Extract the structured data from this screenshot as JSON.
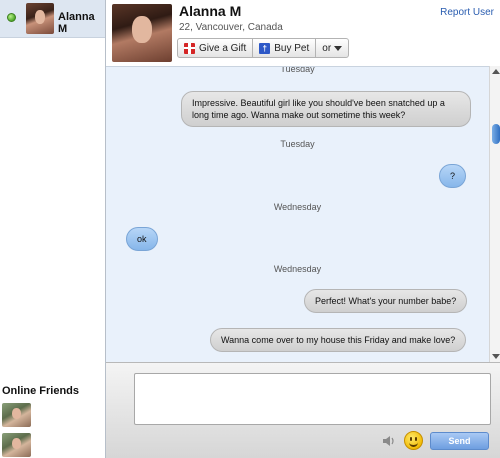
{
  "sidebar": {
    "active_chat": {
      "name": "Alanna M",
      "status": "online"
    },
    "online_friends_title": "Online Friends"
  },
  "profile": {
    "name": "Alanna M",
    "details": "22, Vancouver, Canada",
    "report_label": "Report User"
  },
  "actions": {
    "gift_label": "Give a Gift",
    "pet_label": "Buy Pet",
    "more_label": "or"
  },
  "conversation": {
    "day_top": "Tuesday",
    "msg1": "Impressive. Beautiful girl like you should've been snatched up a long time ago. Wanna make out sometime this week?",
    "day2": "Tuesday",
    "msg2": "?",
    "day3": "Wednesday",
    "msg3": "ok",
    "day4": "Wednesday",
    "msg4": "Perfect! What's your number babe?",
    "msg5": "Wanna come over to my house this Friday and make love?"
  },
  "composer": {
    "input_value": "",
    "send_label": "Send"
  },
  "colors": {
    "accent": "#2a5db0",
    "status_online": "#4fa82a",
    "bubble_mine": "#86b6ea",
    "bubble_theirs": "#cfcfcf"
  }
}
